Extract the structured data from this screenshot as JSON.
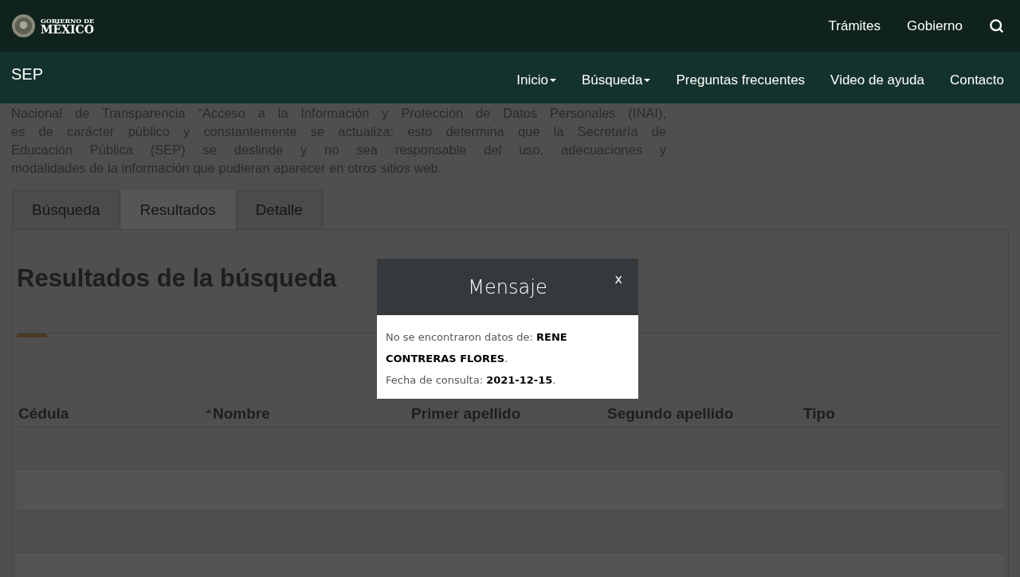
{
  "top_bar": {
    "logo": {
      "line1": "GOBIERNO DE",
      "line2": "MÉXICO"
    },
    "links": [
      "Trámites",
      "Gobierno"
    ]
  },
  "nav": {
    "brand": "SEP",
    "items": [
      {
        "label": "Inicio",
        "dropdown": true
      },
      {
        "label": "Búsqueda",
        "dropdown": true
      },
      {
        "label": "Preguntas frecuentes",
        "dropdown": false
      },
      {
        "label": "Video de ayuda",
        "dropdown": false
      },
      {
        "label": "Contacto",
        "dropdown": false
      }
    ]
  },
  "intro": [
    "Nacional de Transparencia “Acceso a la Información y Protección de Datos Personales (INAI),",
    "es de carácter público y constantemente se actualiza; esto determina que la Secretaría de",
    "Educación Pública (SEP) se deslinde y no sea responsable del uso, adecuaciones y",
    "modalidades de la información que pudieran aparecer en otros sitios web."
  ],
  "tabs": [
    {
      "label": "Búsqueda",
      "selected": false
    },
    {
      "label": "Resultados",
      "selected": true
    },
    {
      "label": "Detalle",
      "selected": false
    }
  ],
  "results": {
    "title": "Resultados de la búsqueda",
    "columns": [
      {
        "label": "Cédula",
        "sorted": false
      },
      {
        "label": "Nombre",
        "sorted": true
      },
      {
        "label": "Primer apellido",
        "sorted": false
      },
      {
        "label": "Segundo apellido",
        "sorted": false
      },
      {
        "label": "Tipo",
        "sorted": false
      }
    ]
  },
  "modal": {
    "title": "Mensaje",
    "close": "x",
    "lines": [
      "No se encontraron datos de: **RENE CONTRERAS FLORES**.",
      "Fecha de consulta: **2021-12-15**."
    ]
  }
}
